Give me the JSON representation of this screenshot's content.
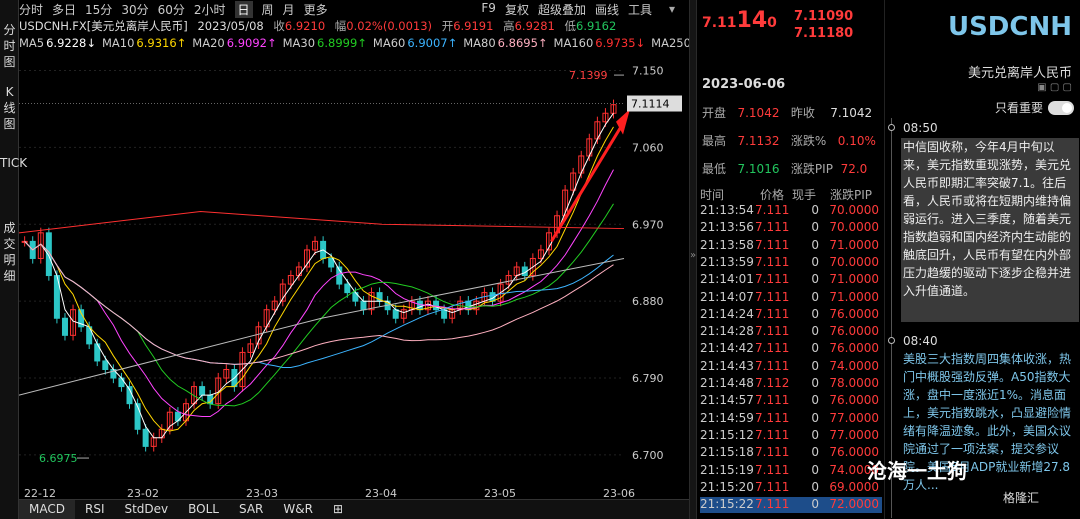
{
  "sidebar": {
    "items": [
      "分时图",
      "K线图",
      "TICK",
      "成交明细"
    ]
  },
  "toolbar": {
    "periods": [
      "分时",
      "多日",
      "15分",
      "30分",
      "60分",
      "2小时",
      "日",
      "周",
      "月",
      "更多"
    ],
    "selected": "日",
    "right": [
      "F9",
      "复权",
      "超级叠加",
      "画线",
      "工具"
    ]
  },
  "info": {
    "symbol": "USDCNH.FX[美元兑离岸人民币]",
    "date": "2023/05/08",
    "close_label": "收",
    "close": "6.9210",
    "chg_label": "幅",
    "chg": "0.02%(0.0013)",
    "open_label": "开",
    "open": "6.9191",
    "high_label": "高",
    "high": "6.9281",
    "low_label": "低",
    "low": "6.9162"
  },
  "ma": [
    {
      "label": "MA5",
      "value": "6.9228↓",
      "color": "#ffffff"
    },
    {
      "label": "MA10",
      "value": "6.9316↑",
      "color": "#ffd700"
    },
    {
      "label": "MA20",
      "value": "6.9092↑",
      "color": "#ff44ff"
    },
    {
      "label": "MA30",
      "value": "6.8999↑",
      "color": "#22cc22"
    },
    {
      "label": "MA60",
      "value": "6.9007↑",
      "color": "#3cb4ff"
    },
    {
      "label": "MA80",
      "value": "6.8695↑",
      "color": "#ffb0c0"
    },
    {
      "label": "MA160",
      "value": "6.9735↓",
      "color": "#ff3030"
    },
    {
      "label": "MA250",
      "value": "",
      "color": "#cccccc"
    }
  ],
  "chart_data": {
    "type": "candlestick",
    "yticks": [
      "7.150",
      "7.060",
      "6.970",
      "6.880",
      "6.790",
      "6.700"
    ],
    "xticks": [
      "22-12",
      "23-02",
      "23-03",
      "23-04",
      "23-05",
      "23-06"
    ],
    "ylim": [
      6.68,
      7.16
    ],
    "high_marker": "7.1399",
    "low_marker": "6.6975",
    "last_price": "7.1114",
    "closes": [
      6.95,
      6.93,
      6.96,
      6.91,
      6.86,
      6.84,
      6.87,
      6.85,
      6.83,
      6.81,
      6.8,
      6.79,
      6.78,
      6.76,
      6.73,
      6.71,
      6.72,
      6.73,
      6.75,
      6.74,
      6.76,
      6.78,
      6.77,
      6.76,
      6.79,
      6.8,
      6.78,
      6.82,
      6.83,
      6.85,
      6.87,
      6.88,
      6.9,
      6.91,
      6.92,
      6.94,
      6.95,
      6.93,
      6.92,
      6.9,
      6.89,
      6.88,
      6.87,
      6.89,
      6.88,
      6.87,
      6.86,
      6.87,
      6.88,
      6.87,
      6.88,
      6.87,
      6.86,
      6.87,
      6.88,
      6.87,
      6.88,
      6.89,
      6.88,
      6.9,
      6.91,
      6.92,
      6.91,
      6.93,
      6.94,
      6.96,
      6.98,
      7.01,
      7.03,
      7.05,
      7.07,
      7.09,
      7.1,
      7.11
    ]
  },
  "bottombar": [
    "MACD",
    "RSI",
    "StdDev",
    "BOLL",
    "SAR",
    "W&R"
  ],
  "quote": {
    "price_prefix": "7.11",
    "price_big": "14",
    "price_suffix": "0",
    "ask": "7.11090",
    "bid": "7.11180",
    "date": "2023-06-06",
    "rows": [
      {
        "k1": "开盘",
        "v1": "7.1042",
        "k2": "昨收",
        "v2": "7.1042"
      },
      {
        "k1": "最高",
        "v1": "7.1132",
        "k2": "涨跌%",
        "v2": "0.10%"
      },
      {
        "k1": "最低",
        "v1": "7.1016",
        "k2": "涨跌PIP",
        "v2": "72.0"
      }
    ],
    "ticks_header": [
      "时间",
      "价格",
      "现手",
      "涨跌PIP"
    ],
    "ticks": [
      [
        "21:13:54",
        "7.111",
        "0",
        "70.0000"
      ],
      [
        "21:13:56",
        "7.111",
        "0",
        "70.0000"
      ],
      [
        "21:13:58",
        "7.111",
        "0",
        "71.0000"
      ],
      [
        "21:13:59",
        "7.111",
        "0",
        "70.0000"
      ],
      [
        "21:14:01",
        "7.111",
        "0",
        "71.0000"
      ],
      [
        "21:14:07",
        "7.111",
        "0",
        "71.0000"
      ],
      [
        "21:14:24",
        "7.111",
        "0",
        "76.0000"
      ],
      [
        "21:14:28",
        "7.111",
        "0",
        "76.0000"
      ],
      [
        "21:14:42",
        "7.111",
        "0",
        "76.0000"
      ],
      [
        "21:14:43",
        "7.111",
        "0",
        "74.0000"
      ],
      [
        "21:14:48",
        "7.112",
        "0",
        "78.0000"
      ],
      [
        "21:14:57",
        "7.111",
        "0",
        "76.0000"
      ],
      [
        "21:14:59",
        "7.111",
        "0",
        "77.0000"
      ],
      [
        "21:15:12",
        "7.111",
        "0",
        "77.0000"
      ],
      [
        "21:15:18",
        "7.111",
        "0",
        "76.0000"
      ],
      [
        "21:15:19",
        "7.111",
        "0",
        "74.0000"
      ],
      [
        "21:15:20",
        "7.111",
        "0",
        "69.0000"
      ],
      [
        "21:15:22",
        "7.111",
        "0",
        "72.0000"
      ]
    ]
  },
  "news": {
    "title": "USDCNH",
    "subtitle": "美元兑离岸人民币",
    "toggle_label": "只看重要",
    "items": [
      {
        "time": "08:50",
        "text": "中信固收称，今年4月中旬以来，美元指数重现涨势，美元兑人民币即期汇率突破7.1。往后看，人民币或将在短期内维持偏弱运行。进入三季度，随着美元指数趋弱和国内经济内生动能的触底回升，人民币有望在内外部压力趋缓的驱动下逐步企稳并进入升值通道。"
      },
      {
        "time": "08:40",
        "text": "美股三大指数周四集体收涨，热门中概股强劲反弹。A50指数大涨，盘中一度涨近1%。消息面上，美元指数跳水，凸显避险情绪有降温迹象。此外，美国众议院通过了一项法案，提交参议院。美国5月ADP就业新增27.8万人..."
      }
    ],
    "watermark": "沧海一土狗",
    "watermark2": "格隆汇"
  }
}
